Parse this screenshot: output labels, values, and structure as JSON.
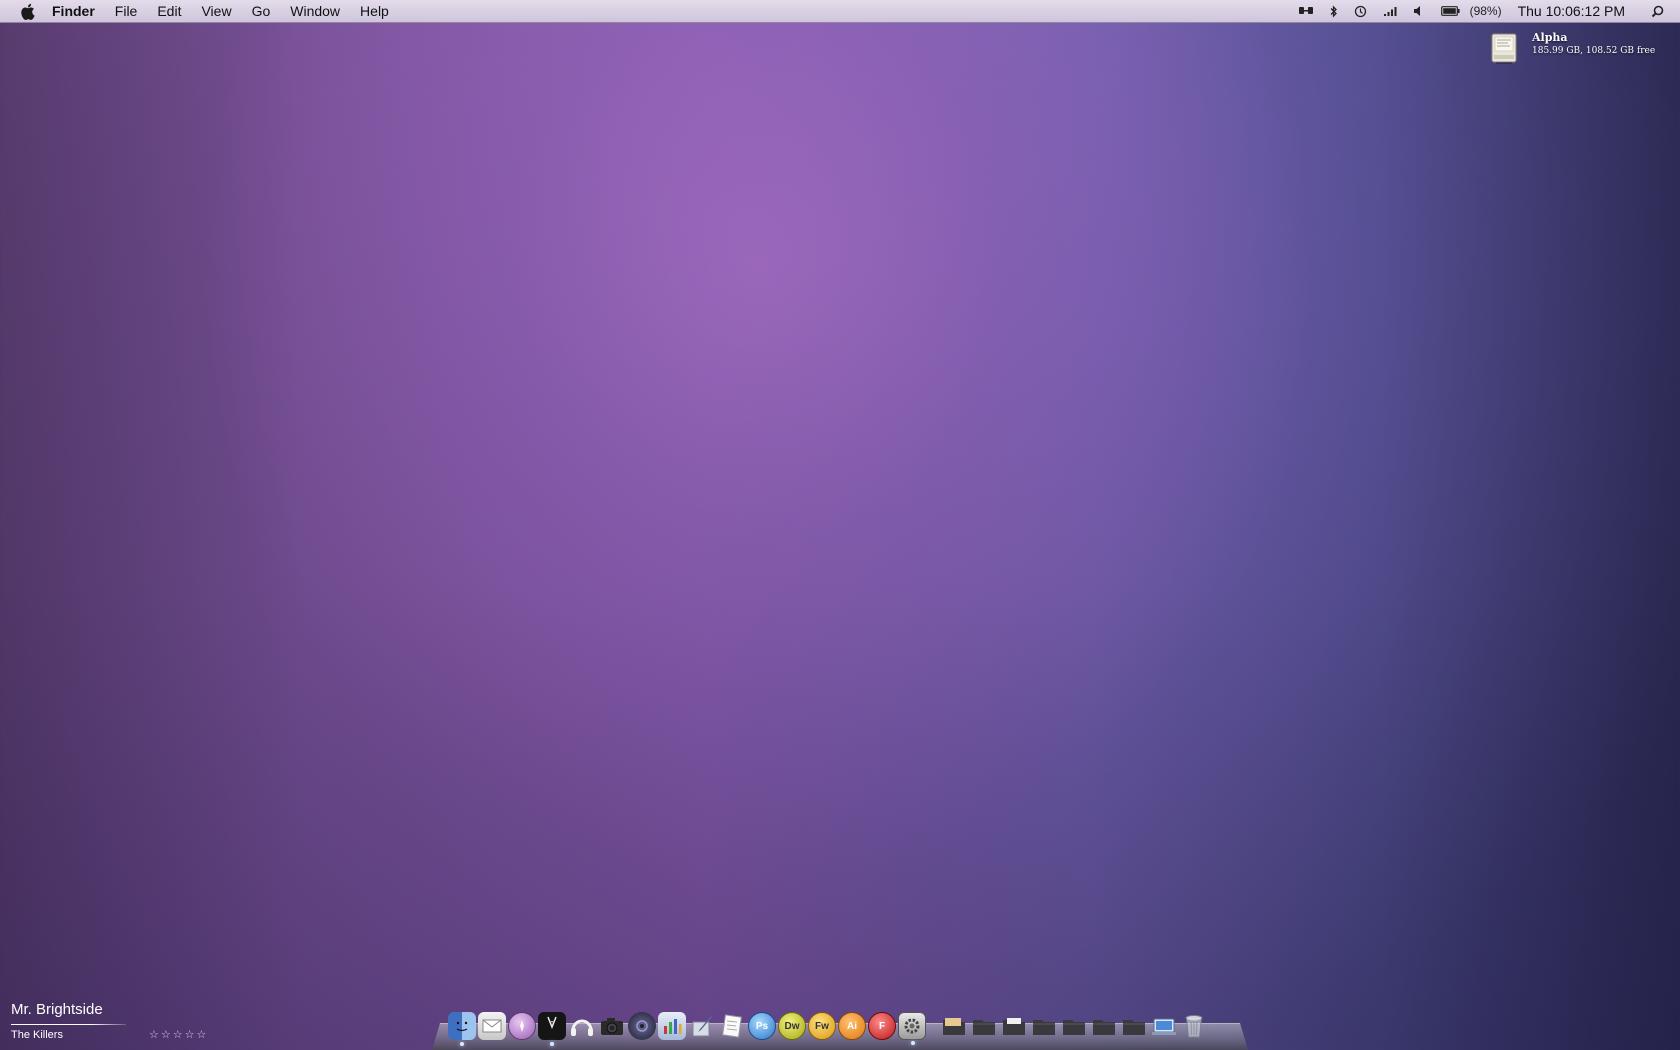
{
  "menubar": {
    "app_name": "Finder",
    "menus": [
      "File",
      "Edit",
      "View",
      "Go",
      "Window",
      "Help"
    ],
    "battery_percent": "(98%)",
    "clock": "Thu 10:06:12 PM"
  },
  "drive": {
    "name": "Alpha",
    "info": "185.99 GB, 108.52 GB free"
  },
  "now_playing": {
    "track": "Mr. Brightside",
    "artist": "The Killers",
    "rating": "☆☆☆☆☆"
  },
  "dock": {
    "apps": [
      {
        "name": "finder-icon",
        "color": "#4a78c8"
      },
      {
        "name": "mail-icon",
        "color": "#d8d8d8"
      },
      {
        "name": "safari-icon",
        "color": "#b070c8"
      },
      {
        "name": "tuxedo-icon",
        "color": "#1a1a1a"
      },
      {
        "name": "headphones-icon",
        "color": "#e0e0e0"
      },
      {
        "name": "camera-icon",
        "color": "#2a2a2a"
      },
      {
        "name": "aperture-icon",
        "color": "#30304a"
      },
      {
        "name": "chart-icon",
        "color": "#3a70b8"
      },
      {
        "name": "pen-icon",
        "color": "#5a6a8a"
      },
      {
        "name": "textedit-icon",
        "color": "#e8e8e8"
      },
      {
        "name": "photoshop-icon",
        "label": "Ps",
        "color": "#3a8ad8"
      },
      {
        "name": "dreamweaver-icon",
        "label": "Dw",
        "color": "#c8c820"
      },
      {
        "name": "fireworks-icon",
        "label": "Fw",
        "color": "#e8b020"
      },
      {
        "name": "illustrator-icon",
        "label": "Ai",
        "color": "#e88a20"
      },
      {
        "name": "flash-icon",
        "label": "F",
        "color": "#c82828"
      },
      {
        "name": "system-preferences-icon",
        "color": "#b8b8b8"
      }
    ],
    "folders": [
      {
        "name": "documents-folder-icon"
      },
      {
        "name": "downloads-folder-icon"
      },
      {
        "name": "applications-folder-icon"
      },
      {
        "name": "pictures-folder-icon"
      },
      {
        "name": "music-folder-icon"
      },
      {
        "name": "movies-folder-icon"
      },
      {
        "name": "home-folder-icon"
      },
      {
        "name": "desktop-folder-icon"
      },
      {
        "name": "trash-icon"
      }
    ]
  }
}
